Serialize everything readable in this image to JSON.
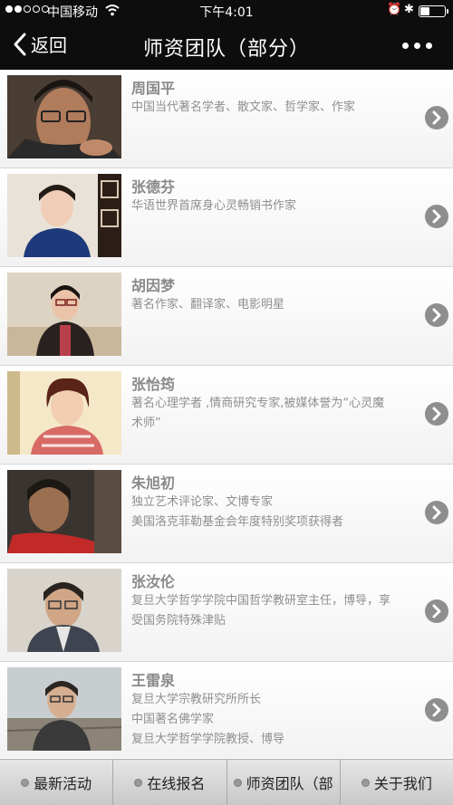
{
  "status_bar": {
    "carrier": "中国移动",
    "time": "下午4:01",
    "signal_dots_filled": 2,
    "signal_dots_total": 5,
    "battery_level": 0.4,
    "icons": [
      "wifi-icon",
      "alarm-icon",
      "bluetooth-icon",
      "battery-icon"
    ]
  },
  "navbar": {
    "back_label": "返回",
    "title": "师资团队（部分）",
    "more_icon": "more-dots-icon"
  },
  "teachers": [
    {
      "name": "周国平",
      "desc": [
        "中国当代著名学者、散文家、哲学家、作家"
      ]
    },
    {
      "name": "张德芬",
      "desc": [
        "华语世界首席身心灵畅销书作家"
      ]
    },
    {
      "name": "胡因梦",
      "desc": [
        "著名作家、翻译家、电影明星"
      ]
    },
    {
      "name": "张怡筠",
      "desc": [
        "著名心理学者 ,情商研究专家,被媒体誉为“心灵魔",
        "术师”"
      ]
    },
    {
      "name": "朱旭初",
      "desc": [
        "独立艺术评论家、文博专家",
        "美国洛克菲勒基金会年度特别奖项获得者"
      ]
    },
    {
      "name": "张汝伦",
      "desc": [
        "复旦大学哲学学院中国哲学教研室主任，博导，享",
        "受国务院特殊津贴"
      ]
    },
    {
      "name": "王雷泉",
      "desc": [
        "复旦大学宗教研究所所长",
        "中国著名佛学家",
        "复旦大学哲学学院教授、博导"
      ]
    }
  ],
  "tabbar": {
    "tabs": [
      {
        "label": "最新活动"
      },
      {
        "label": "在线报名"
      },
      {
        "label": "师资团队（部"
      },
      {
        "label": "关于我们"
      }
    ]
  },
  "colors": {
    "bar_bg": "#0d0d0d",
    "name_text": "#8a8a8a",
    "desc_text": "#8f8f8f",
    "arrow_bg": "#8e8e8e"
  }
}
